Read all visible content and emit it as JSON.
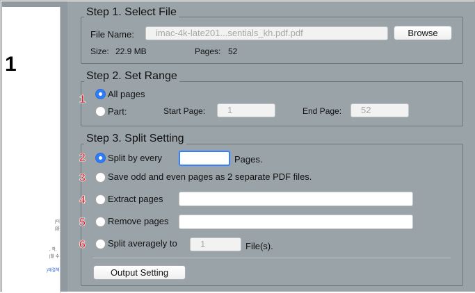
{
  "preview": {
    "page_number": "1",
    "snippets": [
      "|이",
      "|을",
      ", 작,",
      "|할 수",
      "}해결책"
    ]
  },
  "step1": {
    "legend": "Step 1. Select File",
    "file_name_label": "File Name:",
    "file_name_value": "imac-4k-late201...sentials_kh.pdf.pdf",
    "browse_label": "Browse",
    "size_label": "Size:",
    "size_value": "22.9 MB",
    "pages_label": "Pages:",
    "pages_value": "52"
  },
  "step2": {
    "legend": "Step 2. Set Range",
    "marker": "1",
    "all_pages_label": "All pages",
    "all_pages_selected": true,
    "part_label": "Part:",
    "start_page_label": "Start Page:",
    "start_page_placeholder": "1",
    "end_page_label": "End Page:",
    "end_page_placeholder": "52"
  },
  "step3": {
    "legend": "Step 3. Split Setting",
    "options": [
      {
        "marker": "2",
        "label": "Split by every",
        "selected": true,
        "suffix": "Pages."
      },
      {
        "marker": "3",
        "label": "Save odd and even pages as 2 separate PDF files.",
        "selected": false
      },
      {
        "marker": "4",
        "label": "Extract pages",
        "selected": false
      },
      {
        "marker": "5",
        "label": "Remove pages",
        "selected": false
      },
      {
        "marker": "6",
        "label": "Split averagely to",
        "selected": false,
        "placeholder": "1",
        "suffix": "File(s)."
      }
    ],
    "output_button_label": "Output Setting"
  },
  "colors": {
    "panel_bg": "#9aa3a8",
    "radio_selected": "#2f7cf6",
    "marker_red": "#d81f26",
    "focus_ring": "#3c7ff3"
  }
}
